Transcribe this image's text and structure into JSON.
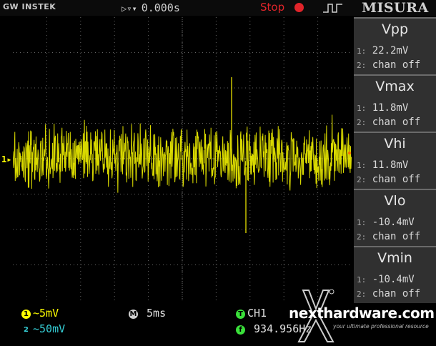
{
  "header": {
    "brand": "GW INSTEK",
    "timebase_offset": "0.000s",
    "run_state": "Stop",
    "watermark": "MISURA"
  },
  "plot": {
    "channel_marker": "1",
    "trace_color": "#ffff00",
    "grid_color": "#666666"
  },
  "measurements": [
    {
      "name": "Vpp",
      "ch1_label": "1:",
      "ch1_value": "22.2mV",
      "ch2_label": "2:",
      "ch2_value": "chan off"
    },
    {
      "name": "Vmax",
      "ch1_label": "1:",
      "ch1_value": "11.8mV",
      "ch2_label": "2:",
      "ch2_value": "chan off"
    },
    {
      "name": "Vhi",
      "ch1_label": "1:",
      "ch1_value": "11.8mV",
      "ch2_label": "2:",
      "ch2_value": "chan off"
    },
    {
      "name": "Vlo",
      "ch1_label": "1:",
      "ch1_value": "-10.4mV",
      "ch2_label": "2:",
      "ch2_value": "chan off"
    },
    {
      "name": "Vmin",
      "ch1_label": "1:",
      "ch1_value": "-10.4mV",
      "ch2_label": "2:",
      "ch2_value": "chan off"
    }
  ],
  "status": {
    "ch1_badge": "1",
    "ch1_coupling": "~",
    "ch1_scale": "5mV",
    "ch2_badge": "2",
    "ch2_coupling": "~",
    "ch2_scale": "50mV",
    "horizontal_badge": "M",
    "horizontal_scale": "5ms",
    "trigger_badge": "T",
    "trigger_source": "CH1",
    "frequency_badge": "f",
    "frequency": "934.956Hz"
  },
  "site": {
    "name": "nexthardware.com",
    "tagline": "your ultimate professional resource"
  }
}
